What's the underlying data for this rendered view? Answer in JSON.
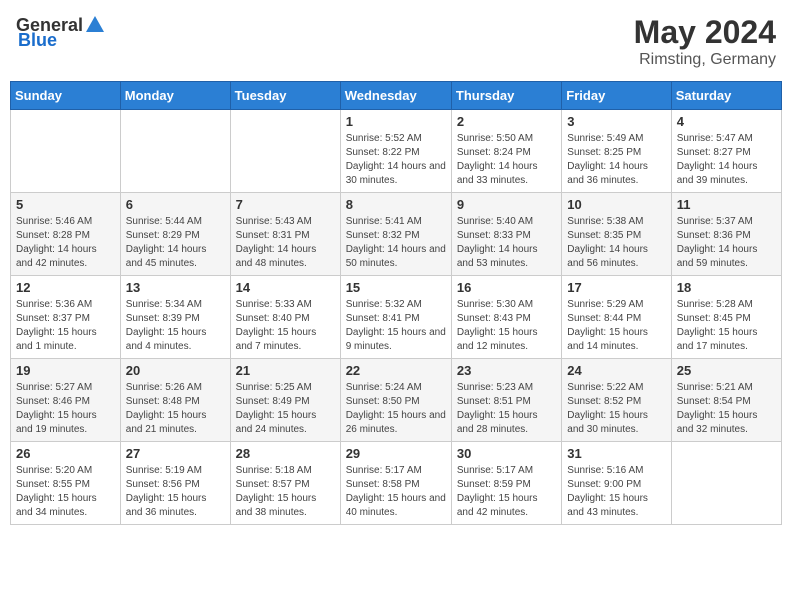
{
  "header": {
    "logo_general": "General",
    "logo_blue": "Blue",
    "month_title": "May 2024",
    "subtitle": "Rimsting, Germany"
  },
  "days_of_week": [
    "Sunday",
    "Monday",
    "Tuesday",
    "Wednesday",
    "Thursday",
    "Friday",
    "Saturday"
  ],
  "weeks": [
    [
      {
        "day": "",
        "info": ""
      },
      {
        "day": "",
        "info": ""
      },
      {
        "day": "",
        "info": ""
      },
      {
        "day": "1",
        "info": "Sunrise: 5:52 AM\nSunset: 8:22 PM\nDaylight: 14 hours and 30 minutes."
      },
      {
        "day": "2",
        "info": "Sunrise: 5:50 AM\nSunset: 8:24 PM\nDaylight: 14 hours and 33 minutes."
      },
      {
        "day": "3",
        "info": "Sunrise: 5:49 AM\nSunset: 8:25 PM\nDaylight: 14 hours and 36 minutes."
      },
      {
        "day": "4",
        "info": "Sunrise: 5:47 AM\nSunset: 8:27 PM\nDaylight: 14 hours and 39 minutes."
      }
    ],
    [
      {
        "day": "5",
        "info": "Sunrise: 5:46 AM\nSunset: 8:28 PM\nDaylight: 14 hours and 42 minutes."
      },
      {
        "day": "6",
        "info": "Sunrise: 5:44 AM\nSunset: 8:29 PM\nDaylight: 14 hours and 45 minutes."
      },
      {
        "day": "7",
        "info": "Sunrise: 5:43 AM\nSunset: 8:31 PM\nDaylight: 14 hours and 48 minutes."
      },
      {
        "day": "8",
        "info": "Sunrise: 5:41 AM\nSunset: 8:32 PM\nDaylight: 14 hours and 50 minutes."
      },
      {
        "day": "9",
        "info": "Sunrise: 5:40 AM\nSunset: 8:33 PM\nDaylight: 14 hours and 53 minutes."
      },
      {
        "day": "10",
        "info": "Sunrise: 5:38 AM\nSunset: 8:35 PM\nDaylight: 14 hours and 56 minutes."
      },
      {
        "day": "11",
        "info": "Sunrise: 5:37 AM\nSunset: 8:36 PM\nDaylight: 14 hours and 59 minutes."
      }
    ],
    [
      {
        "day": "12",
        "info": "Sunrise: 5:36 AM\nSunset: 8:37 PM\nDaylight: 15 hours and 1 minute."
      },
      {
        "day": "13",
        "info": "Sunrise: 5:34 AM\nSunset: 8:39 PM\nDaylight: 15 hours and 4 minutes."
      },
      {
        "day": "14",
        "info": "Sunrise: 5:33 AM\nSunset: 8:40 PM\nDaylight: 15 hours and 7 minutes."
      },
      {
        "day": "15",
        "info": "Sunrise: 5:32 AM\nSunset: 8:41 PM\nDaylight: 15 hours and 9 minutes."
      },
      {
        "day": "16",
        "info": "Sunrise: 5:30 AM\nSunset: 8:43 PM\nDaylight: 15 hours and 12 minutes."
      },
      {
        "day": "17",
        "info": "Sunrise: 5:29 AM\nSunset: 8:44 PM\nDaylight: 15 hours and 14 minutes."
      },
      {
        "day": "18",
        "info": "Sunrise: 5:28 AM\nSunset: 8:45 PM\nDaylight: 15 hours and 17 minutes."
      }
    ],
    [
      {
        "day": "19",
        "info": "Sunrise: 5:27 AM\nSunset: 8:46 PM\nDaylight: 15 hours and 19 minutes."
      },
      {
        "day": "20",
        "info": "Sunrise: 5:26 AM\nSunset: 8:48 PM\nDaylight: 15 hours and 21 minutes."
      },
      {
        "day": "21",
        "info": "Sunrise: 5:25 AM\nSunset: 8:49 PM\nDaylight: 15 hours and 24 minutes."
      },
      {
        "day": "22",
        "info": "Sunrise: 5:24 AM\nSunset: 8:50 PM\nDaylight: 15 hours and 26 minutes."
      },
      {
        "day": "23",
        "info": "Sunrise: 5:23 AM\nSunset: 8:51 PM\nDaylight: 15 hours and 28 minutes."
      },
      {
        "day": "24",
        "info": "Sunrise: 5:22 AM\nSunset: 8:52 PM\nDaylight: 15 hours and 30 minutes."
      },
      {
        "day": "25",
        "info": "Sunrise: 5:21 AM\nSunset: 8:54 PM\nDaylight: 15 hours and 32 minutes."
      }
    ],
    [
      {
        "day": "26",
        "info": "Sunrise: 5:20 AM\nSunset: 8:55 PM\nDaylight: 15 hours and 34 minutes."
      },
      {
        "day": "27",
        "info": "Sunrise: 5:19 AM\nSunset: 8:56 PM\nDaylight: 15 hours and 36 minutes."
      },
      {
        "day": "28",
        "info": "Sunrise: 5:18 AM\nSunset: 8:57 PM\nDaylight: 15 hours and 38 minutes."
      },
      {
        "day": "29",
        "info": "Sunrise: 5:17 AM\nSunset: 8:58 PM\nDaylight: 15 hours and 40 minutes."
      },
      {
        "day": "30",
        "info": "Sunrise: 5:17 AM\nSunset: 8:59 PM\nDaylight: 15 hours and 42 minutes."
      },
      {
        "day": "31",
        "info": "Sunrise: 5:16 AM\nSunset: 9:00 PM\nDaylight: 15 hours and 43 minutes."
      },
      {
        "day": "",
        "info": ""
      }
    ]
  ]
}
